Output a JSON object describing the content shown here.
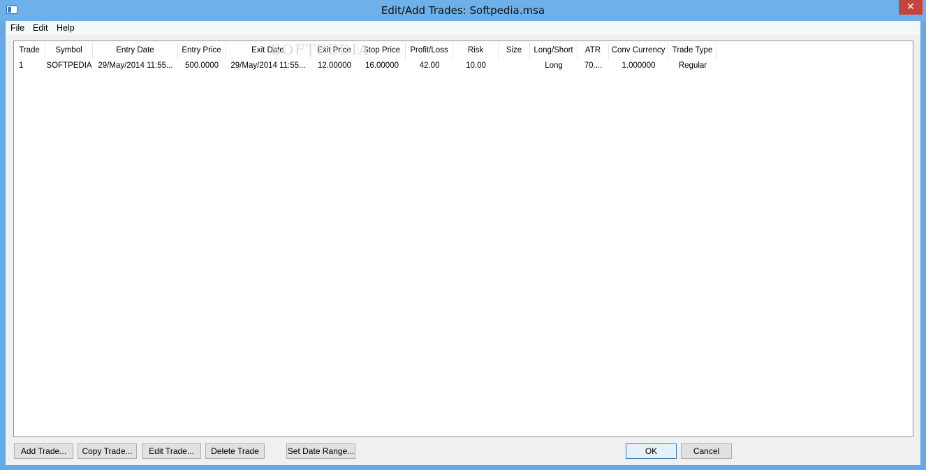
{
  "window": {
    "title": "Edit/Add Trades: Softpedia.msa",
    "close_glyph": "✕"
  },
  "menu": [
    "File",
    "Edit",
    "Help"
  ],
  "watermark": "SOFTPEDIA",
  "table": {
    "columns": [
      "Trade",
      "Symbol",
      "Entry Date",
      "Entry Price",
      "Exit Date",
      "Exit Price",
      "Stop Price",
      "Profit/Loss",
      "Risk",
      "Size",
      "Long/Short",
      "ATR",
      "Conv Currency",
      "Trade Type"
    ],
    "rows": [
      [
        "1",
        "SOFTPEDIA",
        "29/May/2014 11:55...",
        "500.0000",
        "29/May/2014 11:55...",
        "12.00000",
        "16.00000",
        "42.00",
        "10.00",
        "",
        "Long",
        "70....",
        "1.000000",
        "Regular"
      ]
    ]
  },
  "buttons": {
    "add": "Add Trade...",
    "copy": "Copy Trade...",
    "edit": "Edit Trade...",
    "delete": "Delete Trade",
    "date_range": "Set Date Range...",
    "ok": "OK",
    "cancel": "Cancel"
  }
}
